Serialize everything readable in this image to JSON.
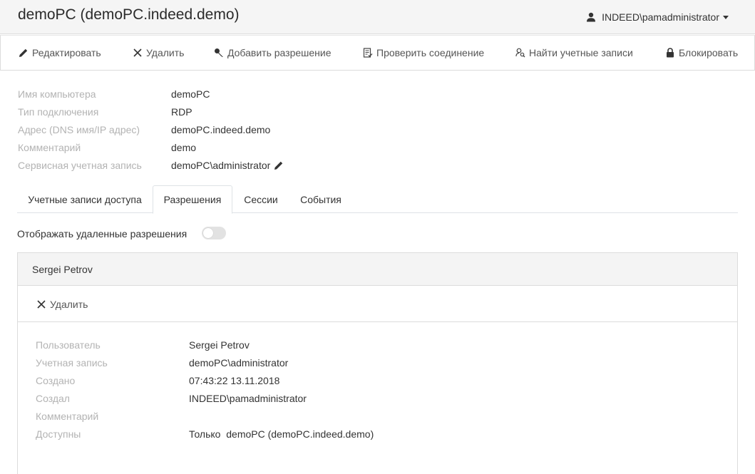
{
  "header": {
    "title": "demoPC (demoPC.indeed.demo)",
    "user": "INDEED\\pamadministrator"
  },
  "toolbar": {
    "edit": "Редактировать",
    "delete": "Удалить",
    "add_permission": "Добавить разрешение",
    "check_connection": "Проверить соединение",
    "find_accounts": "Найти учетные записи",
    "block": "Блокировать"
  },
  "properties": [
    {
      "label": "Имя компьютера",
      "value": "demoPC"
    },
    {
      "label": "Тип подключения",
      "value": "RDP"
    },
    {
      "label": "Адрес (DNS имя/IP адрес)",
      "value": "demoPC.indeed.demo"
    },
    {
      "label": "Комментарий",
      "value": "demo"
    },
    {
      "label": "Сервисная учетная запись",
      "value": "demoPC\\administrator"
    }
  ],
  "tabs": [
    {
      "label": "Учетные записи доступа"
    },
    {
      "label": "Разрешения",
      "active": true
    },
    {
      "label": "Сессии"
    },
    {
      "label": "События"
    }
  ],
  "show_deleted": {
    "label": "Отображать удаленные разрешения",
    "enabled": false
  },
  "permission": {
    "title": "Sergei Petrov",
    "delete": "Удалить",
    "fields": [
      {
        "label": "Пользователь",
        "value": "Sergei Petrov"
      },
      {
        "label": "Учетная запись",
        "value": "demoPC\\administrator"
      },
      {
        "label": "Создано",
        "value": "07:43:22 13.11.2018"
      },
      {
        "label": "Создал",
        "value": "INDEED\\pamadministrator"
      },
      {
        "label": "Комментарий",
        "value": ""
      },
      {
        "label": "Доступны",
        "value": "Только  demoPC (demoPC.indeed.demo)"
      }
    ]
  },
  "colors": {
    "label_gray": "#b3b3b3",
    "text": "#333333",
    "header_bg": "#f5f5f5",
    "border": "#dcdcdc"
  }
}
